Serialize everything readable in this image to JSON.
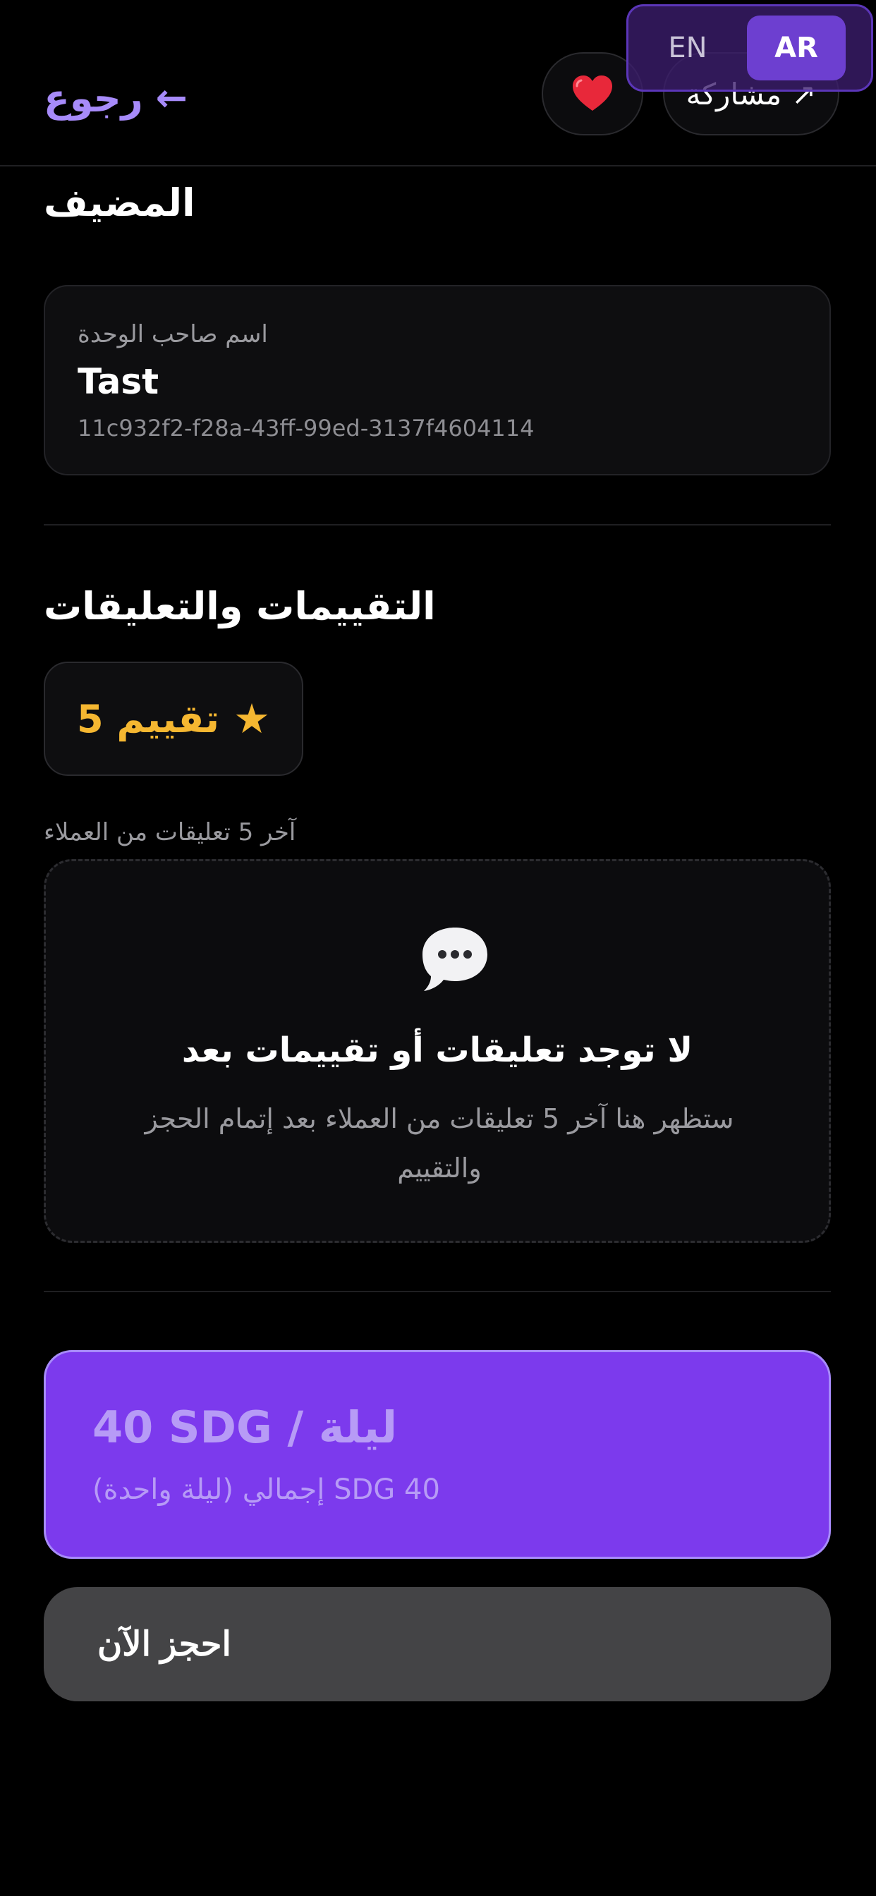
{
  "header": {
    "back_label": "رجوع",
    "share_label": "مشاركة",
    "favorite_icon": "heart-icon",
    "language": {
      "options": [
        "EN",
        "AR"
      ],
      "selected": "AR"
    }
  },
  "host": {
    "section_title": "المضيف",
    "label": "اسم صاحب الوحدة",
    "name": "Tast",
    "id": "11c932f2-f28a-43ff-99ed-3137f4604114"
  },
  "reviews": {
    "section_title": "التقييمات والتعليقات",
    "rating_count_label": "5 تقييم",
    "last_comments_label": "آخر 5 تعليقات من العملاء",
    "empty_title": "لا توجد تعليقات أو تقييمات بعد",
    "empty_description": "ستظهر هنا آخر 5 تعليقات من العملاء بعد إتمام الحجز والتقييم"
  },
  "pricing": {
    "price_per_night": "40 SDG / ليلة",
    "total_label": "إجمالي (ليلة واحدة) SDG 40"
  },
  "actions": {
    "book_now_label": "احجز الآن"
  },
  "colors": {
    "accent": "#a78bfa",
    "price_card": "#7c3aed",
    "star": "#f5b731",
    "book_button": "#444446"
  }
}
